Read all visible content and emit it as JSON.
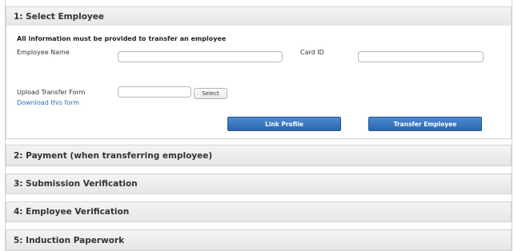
{
  "steps": {
    "s1": "1: Select Employee",
    "s2": "2: Payment (when transferring employee)",
    "s3": "3: Submission Verification",
    "s4": "4: Employee Verification",
    "s5": "5: Induction Paperwork"
  },
  "form": {
    "note": "All information must be provided to transfer an employee",
    "employee_name_label": "Employee Name",
    "employee_name_value": "",
    "card_id_label": "Card ID",
    "card_id_value": "",
    "upload_label": "Upload Transfer Form",
    "upload_value": "",
    "select_button": "Select",
    "download_link": "Download this form",
    "link_profile_button": "Link Profile",
    "transfer_button": "Transfer Employee"
  },
  "colors": {
    "header_bg": "#ececec",
    "primary_button": "#3574bf",
    "link": "#2d6db4"
  }
}
